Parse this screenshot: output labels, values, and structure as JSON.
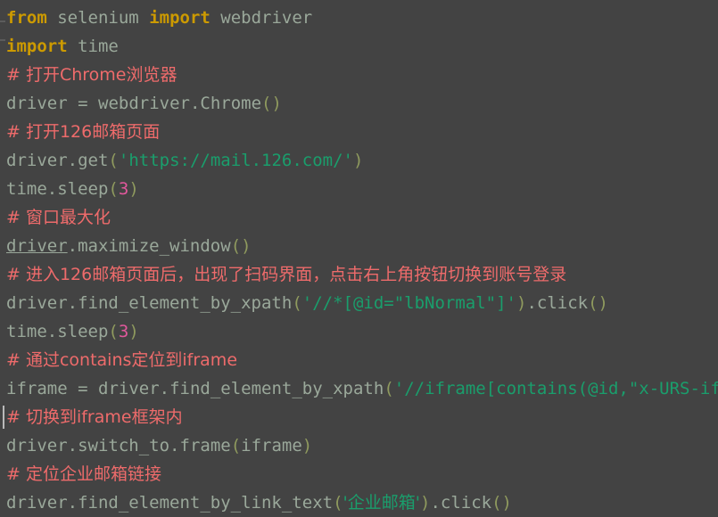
{
  "editor": {
    "theme_name": "darcula",
    "background_color": "#434343",
    "font_size_px": 19,
    "line_height_px": 32,
    "language": "python",
    "cursor_line_index": 13,
    "colors": {
      "keyword": "#cc9a00",
      "identifier": "#9aa89a",
      "comment": "#ee6b6b",
      "string": "#1a9e6c",
      "number": "#e1589c",
      "punctuation": "#8f9a5e",
      "caret": "#b9b9b9",
      "fold_marker": "#5c5c5c"
    },
    "gutter": {
      "fold_marker_1": "fold-collapse-icon",
      "fold_marker_2": "fold-collapse-icon"
    }
  },
  "lines": [
    {
      "index": 0,
      "text": "from selenium import webdriver",
      "tokens": [
        {
          "t": "from",
          "c": "kw"
        },
        {
          "t": " ",
          "c": "plain"
        },
        {
          "t": "selenium",
          "c": "ident"
        },
        {
          "t": " ",
          "c": "plain"
        },
        {
          "t": "import",
          "c": "kw"
        },
        {
          "t": " ",
          "c": "plain"
        },
        {
          "t": "webdriver",
          "c": "ident"
        }
      ]
    },
    {
      "index": 1,
      "text": "import time",
      "tokens": [
        {
          "t": "import",
          "c": "kw"
        },
        {
          "t": " ",
          "c": "plain"
        },
        {
          "t": "time",
          "c": "ident"
        }
      ]
    },
    {
      "index": 2,
      "text": "# 打开Chrome浏览器",
      "tokens": [
        {
          "t": "# 打开Chrome浏览器",
          "c": "comment cjk"
        }
      ]
    },
    {
      "index": 3,
      "text": "driver = webdriver.Chrome()",
      "tokens": [
        {
          "t": "driver",
          "c": "ident"
        },
        {
          "t": " ",
          "c": "plain"
        },
        {
          "t": "=",
          "c": "op"
        },
        {
          "t": " ",
          "c": "plain"
        },
        {
          "t": "webdriver",
          "c": "ident"
        },
        {
          "t": ".",
          "c": "ident"
        },
        {
          "t": "Chrome",
          "c": "ident"
        },
        {
          "t": "()",
          "c": "punc"
        }
      ]
    },
    {
      "index": 4,
      "text": "# 打开126邮箱页面",
      "tokens": [
        {
          "t": "# 打开126邮箱页面",
          "c": "comment cjk"
        }
      ]
    },
    {
      "index": 5,
      "text": "driver.get('https://mail.126.com/')",
      "tokens": [
        {
          "t": "driver",
          "c": "ident"
        },
        {
          "t": ".",
          "c": "ident"
        },
        {
          "t": "get",
          "c": "ident"
        },
        {
          "t": "(",
          "c": "punc"
        },
        {
          "t": "'https://mail.126.com/'",
          "c": "str"
        },
        {
          "t": ")",
          "c": "punc"
        }
      ]
    },
    {
      "index": 6,
      "text": "time.sleep(3)",
      "tokens": [
        {
          "t": "time",
          "c": "ident"
        },
        {
          "t": ".",
          "c": "ident"
        },
        {
          "t": "sleep",
          "c": "ident"
        },
        {
          "t": "(",
          "c": "punc"
        },
        {
          "t": "3",
          "c": "num"
        },
        {
          "t": ")",
          "c": "punc"
        }
      ]
    },
    {
      "index": 7,
      "text": "# 窗口最大化",
      "tokens": [
        {
          "t": "# 窗口最大化",
          "c": "comment cjk"
        }
      ]
    },
    {
      "index": 8,
      "text": "driver.maximize_window()",
      "tokens": [
        {
          "t": "driver",
          "c": "link"
        },
        {
          "t": ".",
          "c": "ident"
        },
        {
          "t": "maximize_window",
          "c": "ident"
        },
        {
          "t": "()",
          "c": "punc"
        }
      ]
    },
    {
      "index": 9,
      "text": "# 进入126邮箱页面后，出现了扫码界面，点击右上角按钮切换到账号登录",
      "tokens": [
        {
          "t": "# 进入126邮箱页面后，出现了扫码界面，点击右上角按钮切换到账号登录",
          "c": "comment cjk"
        }
      ]
    },
    {
      "index": 10,
      "text": "driver.find_element_by_xpath('//*[@id=\"lbNormal\"]').click()",
      "tokens": [
        {
          "t": "driver",
          "c": "ident"
        },
        {
          "t": ".",
          "c": "ident"
        },
        {
          "t": "find_element_by_xpath",
          "c": "ident"
        },
        {
          "t": "(",
          "c": "punc"
        },
        {
          "t": "'//*[@id=\"lbNormal\"]'",
          "c": "str"
        },
        {
          "t": ")",
          "c": "punc"
        },
        {
          "t": ".",
          "c": "ident"
        },
        {
          "t": "click",
          "c": "ident"
        },
        {
          "t": "()",
          "c": "punc"
        }
      ]
    },
    {
      "index": 11,
      "text": "time.sleep(3)",
      "tokens": [
        {
          "t": "time",
          "c": "ident"
        },
        {
          "t": ".",
          "c": "ident"
        },
        {
          "t": "sleep",
          "c": "ident"
        },
        {
          "t": "(",
          "c": "punc"
        },
        {
          "t": "3",
          "c": "num"
        },
        {
          "t": ")",
          "c": "punc"
        }
      ]
    },
    {
      "index": 12,
      "text": "# 通过contains定位到iframe",
      "tokens": [
        {
          "t": "# 通过contains定位到iframe",
          "c": "comment cjk"
        }
      ]
    },
    {
      "index": 13,
      "text": "iframe = driver.find_element_by_xpath('//iframe[contains(@id,\"x-URS-iframe\")]')",
      "tokens": [
        {
          "t": "iframe",
          "c": "ident"
        },
        {
          "t": " ",
          "c": "plain"
        },
        {
          "t": "=",
          "c": "op"
        },
        {
          "t": " ",
          "c": "plain"
        },
        {
          "t": "driver",
          "c": "ident"
        },
        {
          "t": ".",
          "c": "ident"
        },
        {
          "t": "find_element_by_xpath",
          "c": "ident"
        },
        {
          "t": "(",
          "c": "punc"
        },
        {
          "t": "'//iframe[contains(@id,\"x-URS-iframe\")]'",
          "c": "str"
        },
        {
          "t": ")",
          "c": "punc"
        }
      ]
    },
    {
      "index": 14,
      "text": "# 切换到iframe框架内",
      "has_caret": true,
      "tokens": [
        {
          "t": "# 切换到iframe框架内",
          "c": "comment cjk"
        }
      ]
    },
    {
      "index": 15,
      "text": "driver.switch_to.frame(iframe)",
      "tokens": [
        {
          "t": "driver",
          "c": "ident"
        },
        {
          "t": ".",
          "c": "ident"
        },
        {
          "t": "switch_to",
          "c": "ident"
        },
        {
          "t": ".",
          "c": "ident"
        },
        {
          "t": "frame",
          "c": "ident"
        },
        {
          "t": "(",
          "c": "punc"
        },
        {
          "t": "iframe",
          "c": "ident"
        },
        {
          "t": ")",
          "c": "punc"
        }
      ]
    },
    {
      "index": 16,
      "text": "# 定位企业邮箱链接",
      "tokens": [
        {
          "t": "# 定位企业邮箱链接",
          "c": "comment cjk"
        }
      ]
    },
    {
      "index": 17,
      "text": "driver.find_element_by_link_text('企业邮箱').click()",
      "tokens": [
        {
          "t": "driver",
          "c": "ident"
        },
        {
          "t": ".",
          "c": "ident"
        },
        {
          "t": "find_element_by_link_text",
          "c": "ident"
        },
        {
          "t": "(",
          "c": "punc"
        },
        {
          "t": "'企业邮箱'",
          "c": "str cjk"
        },
        {
          "t": ")",
          "c": "punc"
        },
        {
          "t": ".",
          "c": "ident"
        },
        {
          "t": "click",
          "c": "ident"
        },
        {
          "t": "()",
          "c": "punc"
        }
      ]
    }
  ]
}
